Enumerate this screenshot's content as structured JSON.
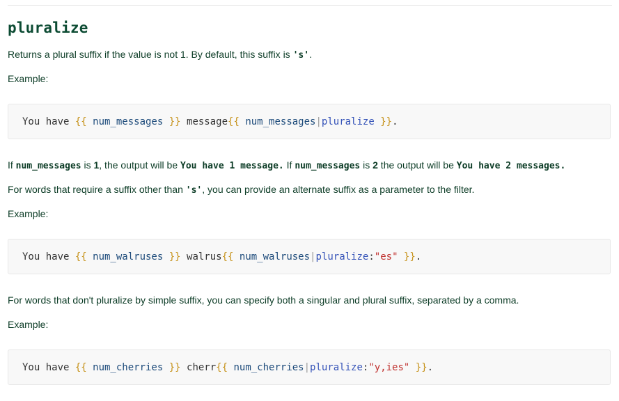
{
  "title": "pluralize",
  "intro": {
    "text": "Returns a plural suffix if the value is not 1. By default, this suffix is ",
    "code": "'s'",
    "end": "."
  },
  "example_label": "Example:",
  "block1": {
    "prefix": "You have ",
    "open": "{{",
    "var": " num_messages ",
    "close": "}}",
    "mid": " message",
    "open2": "{{",
    "var2": " num_messages",
    "pipe": "|",
    "filter": "pluralize",
    "arg_colon": "",
    "arg": "",
    "close2": " }}",
    "end": "."
  },
  "output_para": {
    "t1": "If ",
    "c1": "num_messages",
    "t2": " is ",
    "n1": "1",
    "t3": ", the output will be ",
    "c2": "You have 1 message.",
    "t4": " If ",
    "c3": "num_messages",
    "t5": " is ",
    "n2": "2",
    "t6": " the output will be ",
    "c4": "You have 2 messages."
  },
  "alt_suffix": {
    "t1": "For words that require a suffix other than ",
    "code": "'s'",
    "t2": ", you can provide an alternate suffix as a parameter to the filter."
  },
  "block2": {
    "prefix": "You have ",
    "open": "{{",
    "var": " num_walruses ",
    "close": "}}",
    "mid": " walrus",
    "open2": "{{",
    "var2": " num_walruses",
    "pipe": "|",
    "filter": "pluralize",
    "arg_colon": ":",
    "arg": "\"es\"",
    "close2": " }}",
    "end": "."
  },
  "comma_para": "For words that don't pluralize by simple suffix, you can specify both a singular and plural suffix, separated by a comma.",
  "block3": {
    "prefix": "You have ",
    "open": "{{",
    "var": " num_cherries ",
    "close": "}}",
    "mid": " cherr",
    "open2": "{{",
    "var2": " num_cherries",
    "pipe": "|",
    "filter": "pluralize",
    "arg_colon": ":",
    "arg": "\"y,ies\"",
    "close2": " }}",
    "end": "."
  }
}
